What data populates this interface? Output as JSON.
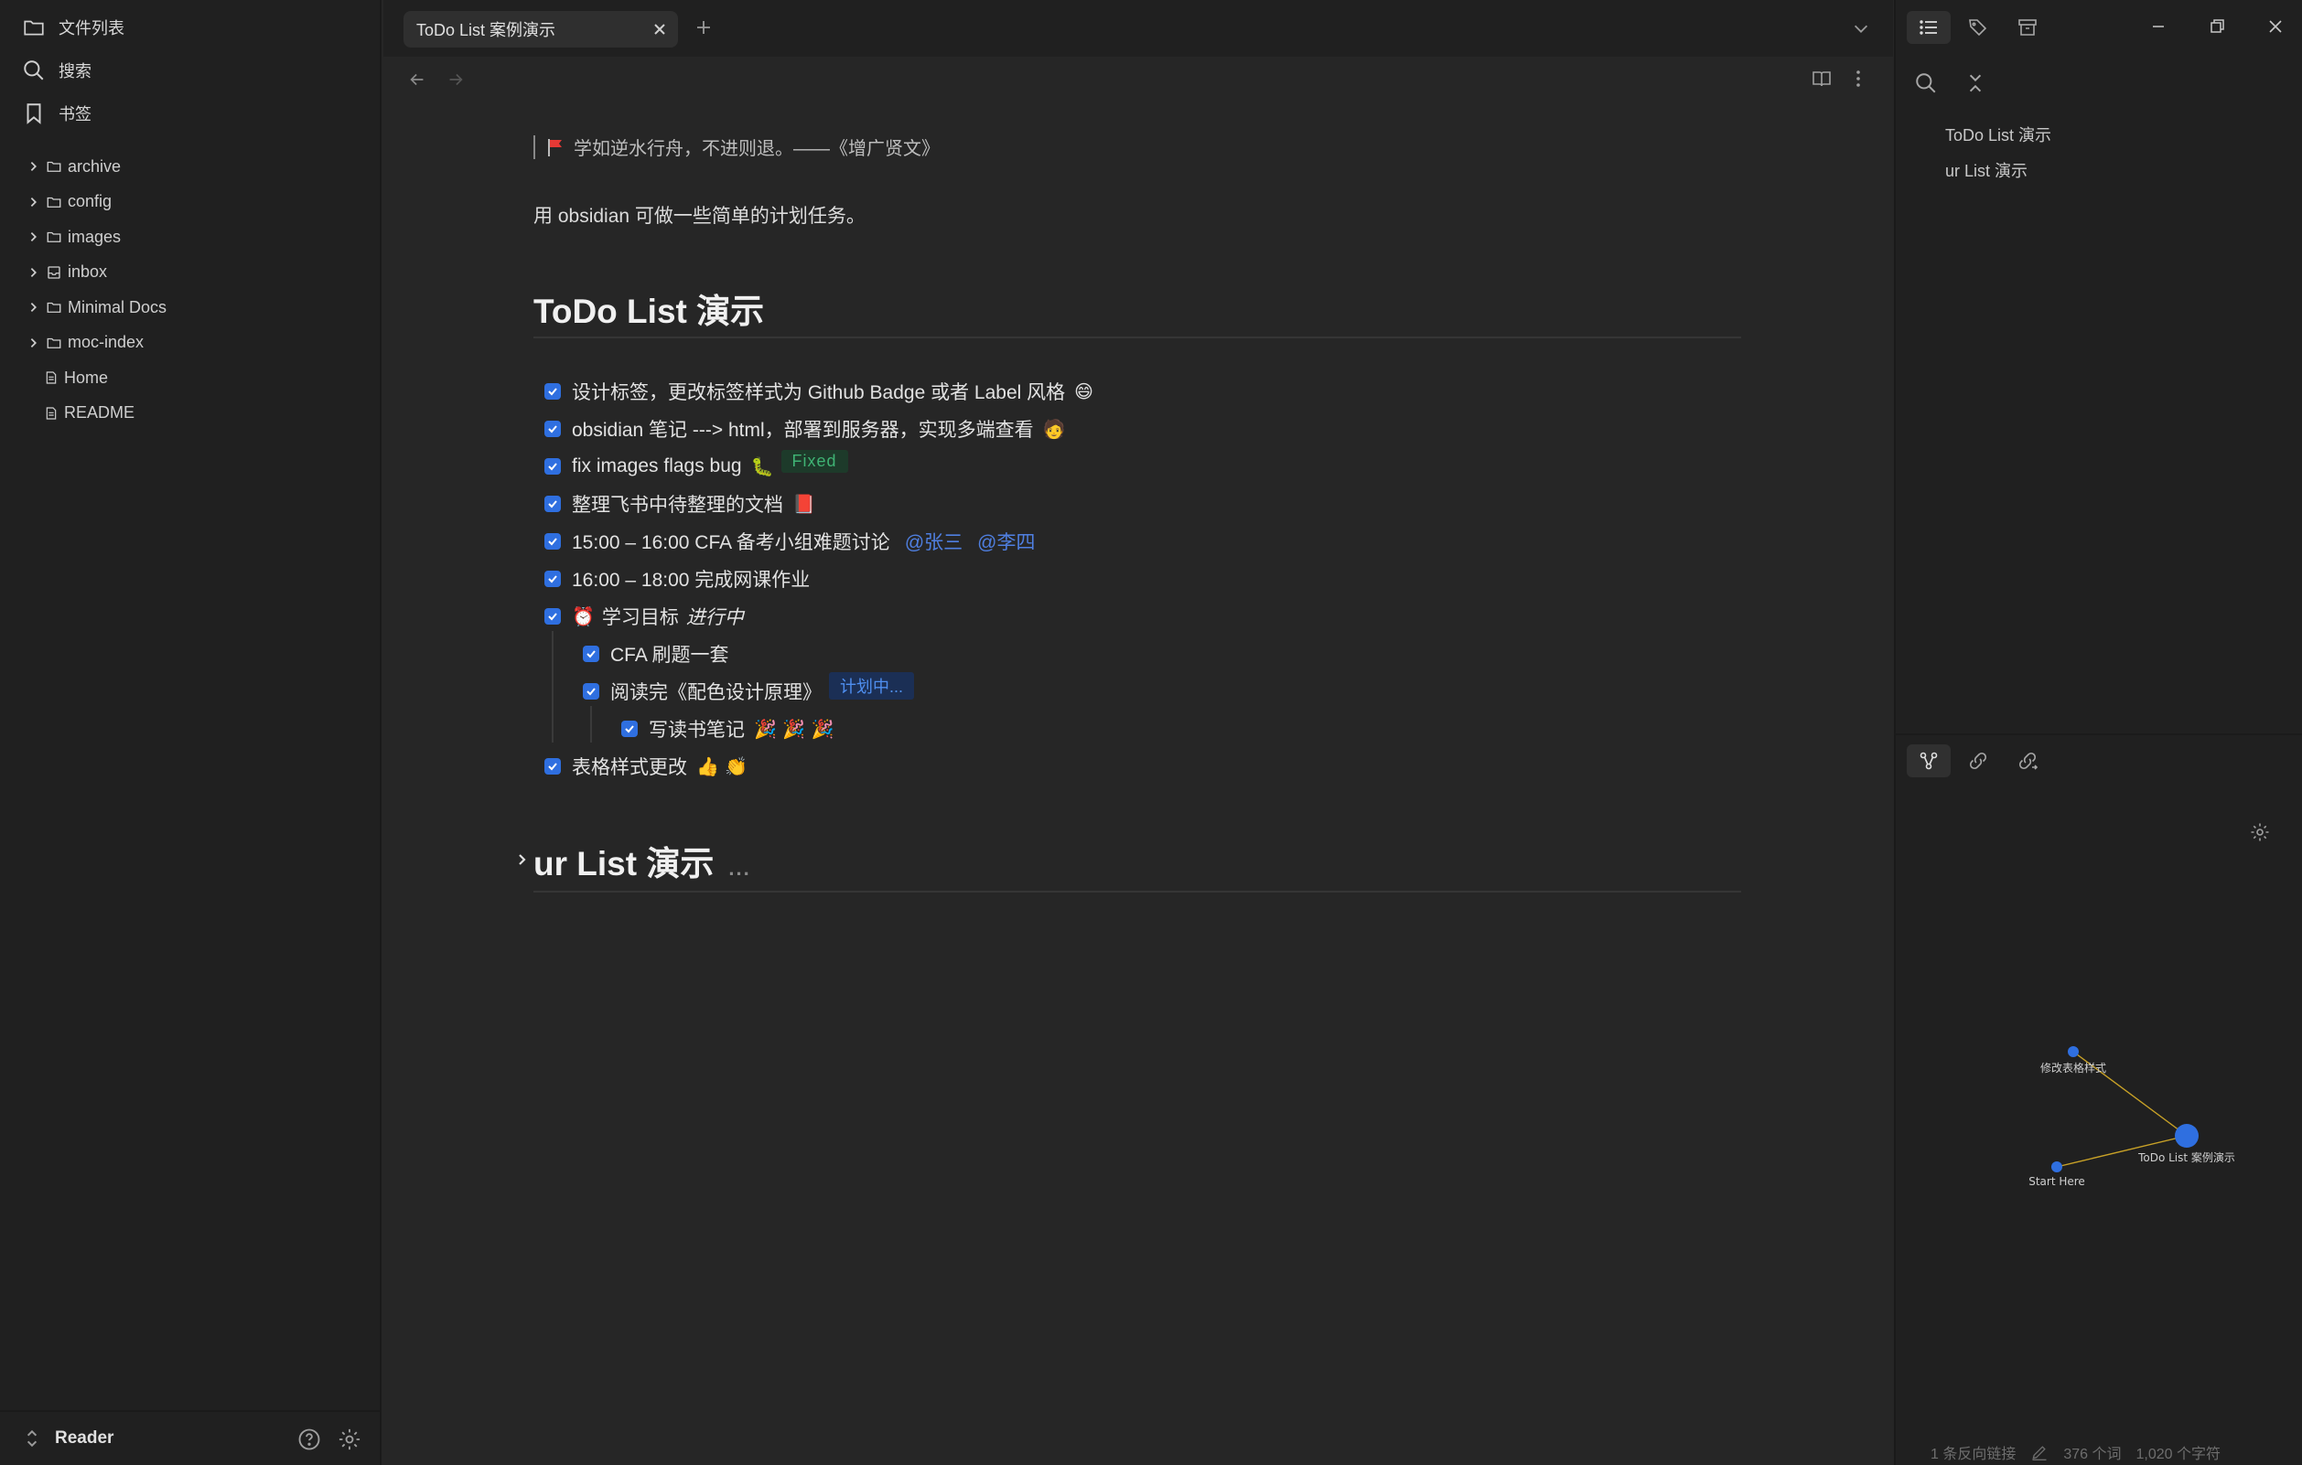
{
  "sidebar": {
    "file_list": "文件列表",
    "search": "搜索",
    "bookmarks": "书签",
    "tree": [
      {
        "label": "archive",
        "type": "folder"
      },
      {
        "label": "config",
        "type": "folder"
      },
      {
        "label": "images",
        "type": "folder"
      },
      {
        "label": "inbox",
        "type": "folder"
      },
      {
        "label": "Minimal Docs",
        "type": "folder"
      },
      {
        "label": "moc-index",
        "type": "folder"
      },
      {
        "label": "Home",
        "type": "file"
      },
      {
        "label": "README",
        "type": "file"
      }
    ],
    "vault_name": "Reader"
  },
  "tabs": [
    {
      "label": "ToDo List 案例演示",
      "active": true
    }
  ],
  "document": {
    "quote": "学如逆水行舟，不进则退。——《增广贤文》",
    "intro": "用 obsidian 可做一些简单的计划任务。",
    "heading1": "ToDo List 演示",
    "heading2": "ur List 演示",
    "heading2_collapsed_dots": "...",
    "tasks": [
      {
        "text": "设计标签，更改标签样式为 Github Badge 或者 Label 风格",
        "emoji": "😄",
        "checked": true
      },
      {
        "text": "obsidian 笔记 ---> html，部署到服务器，实现多端查看",
        "emoji": "🧑",
        "checked": true
      },
      {
        "text": "fix images flags bug",
        "emoji": "🐛",
        "badge": "Fixed",
        "checked": true
      },
      {
        "text": "整理飞书中待整理的文档",
        "emoji": "📕",
        "checked": true
      },
      {
        "text": "15:00 – 16:00 CFA 备考小组难题讨论",
        "mentions": [
          "@张三",
          "@李四"
        ],
        "checked": true
      },
      {
        "text": "16:00 – 18:00 完成网课作业",
        "checked": true
      },
      {
        "text": "学习目标",
        "prefix_emoji": "⏰",
        "italic": "进行中",
        "checked": true
      },
      {
        "text": "CFA 刷题一套",
        "checked": true,
        "level": 1
      },
      {
        "text": "阅读完《配色设计原理》",
        "badge": "计划中...",
        "checked": true,
        "level": 1
      },
      {
        "text": "写读书笔记",
        "emoji": "🎉 🎉 🎉",
        "checked": true,
        "level": 2
      },
      {
        "text": "表格样式更改",
        "emoji": "👍 👏",
        "checked": true
      }
    ]
  },
  "outline": {
    "items": [
      "ToDo List 演示",
      "ur List 演示"
    ]
  },
  "graph": {
    "nodes": [
      {
        "label": "修改表格样式"
      },
      {
        "label": "ToDo List 案例演示"
      },
      {
        "label": "Start Here"
      }
    ]
  },
  "status_bar": {
    "backlinks": "1 条反向链接",
    "words": "376 个词",
    "chars": "1,020 个字符"
  },
  "colors": {
    "accent": "#2f6fe0",
    "fixed_badge_text": "#3fb374",
    "plan_badge_text": "#4f8ff0",
    "mention": "#4f7fe0"
  }
}
